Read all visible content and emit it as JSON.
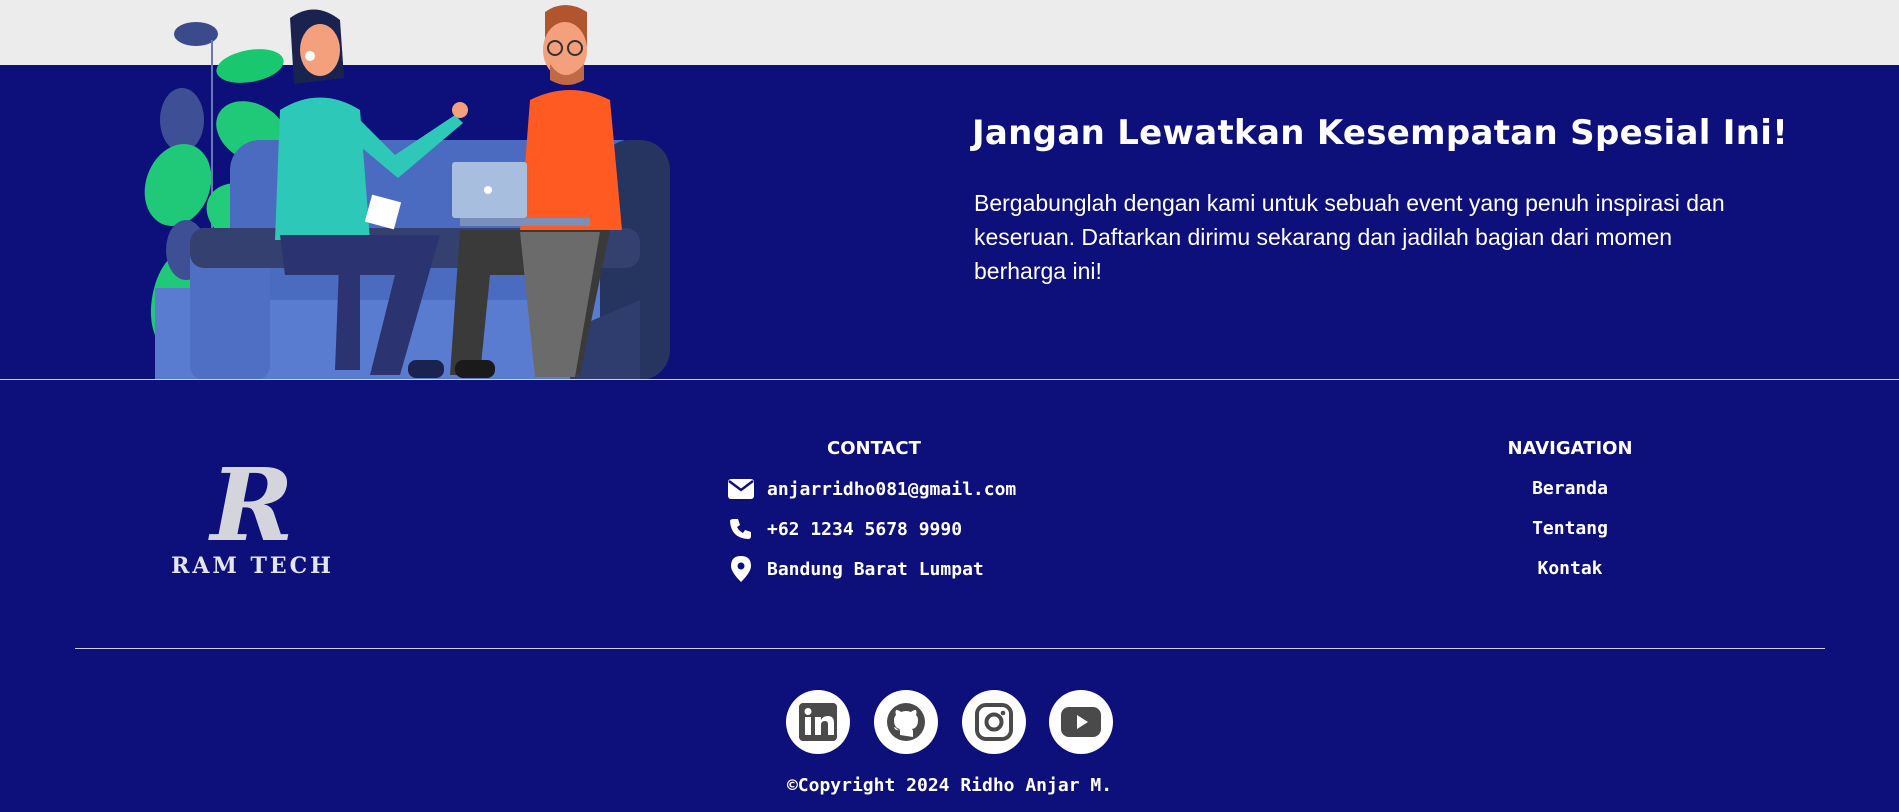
{
  "hero": {
    "title": "Jangan Lewatkan Kesempatan Spesial Ini!",
    "text": "Bergabunglah dengan kami untuk sebuah event yang penuh inspirasi dan keseruan. Daftarkan dirimu sekarang dan jadilah bagian dari momen berharga ini!"
  },
  "footer": {
    "logo": {
      "mark": "R",
      "text": "RAM TECH"
    },
    "contact": {
      "title": "CONTACT",
      "items": [
        {
          "icon": "envelope-icon",
          "label": "anjarridho081@gmail.com"
        },
        {
          "icon": "phone-icon",
          "label": "+62 1234 5678 9990"
        },
        {
          "icon": "location-pin-icon",
          "label": "Bandung Barat Lumpat"
        }
      ]
    },
    "navigation": {
      "title": "NAVIGATION",
      "items": [
        "Beranda",
        "Tentang",
        "Kontak"
      ]
    },
    "social": [
      "linkedin-icon",
      "github-icon",
      "instagram-icon",
      "youtube-icon"
    ],
    "copyright": "©Copyright 2024 Ridho Anjar M."
  },
  "colors": {
    "background": "#0d0f7a",
    "top_band": "#ececec",
    "text": "#ffffff",
    "icon_dark": "#4a4a4a"
  }
}
